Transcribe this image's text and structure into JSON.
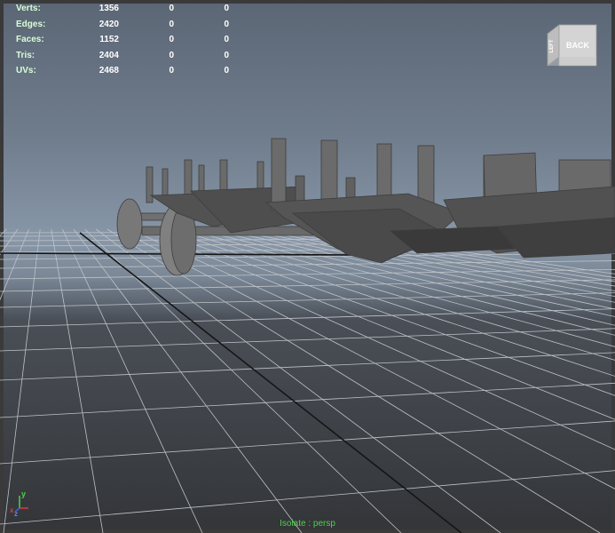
{
  "hud": {
    "rows": [
      {
        "label": "Verts:",
        "v1": "1356",
        "v2": "0",
        "v3": "0"
      },
      {
        "label": "Edges:",
        "v1": "2420",
        "v2": "0",
        "v3": "0"
      },
      {
        "label": "Faces:",
        "v1": "1152",
        "v2": "0",
        "v3": "0"
      },
      {
        "label": "Tris:",
        "v1": "2404",
        "v2": "0",
        "v3": "0"
      },
      {
        "label": "UVs:",
        "v1": "2468",
        "v2": "0",
        "v3": "0"
      }
    ]
  },
  "view_cube": {
    "front_label": "BACK",
    "side_label": "LEFT"
  },
  "axis": {
    "y_label": "y",
    "x_label": "x",
    "z_label": "z"
  },
  "camera": {
    "label": "Isolate : persp"
  },
  "colors": {
    "grid_line": "#c8c8c8",
    "origin_axis": "#1a1a1a",
    "hud_text": "#ffffff",
    "camera_label": "#4fd04f",
    "model": "#5a5a5a"
  }
}
